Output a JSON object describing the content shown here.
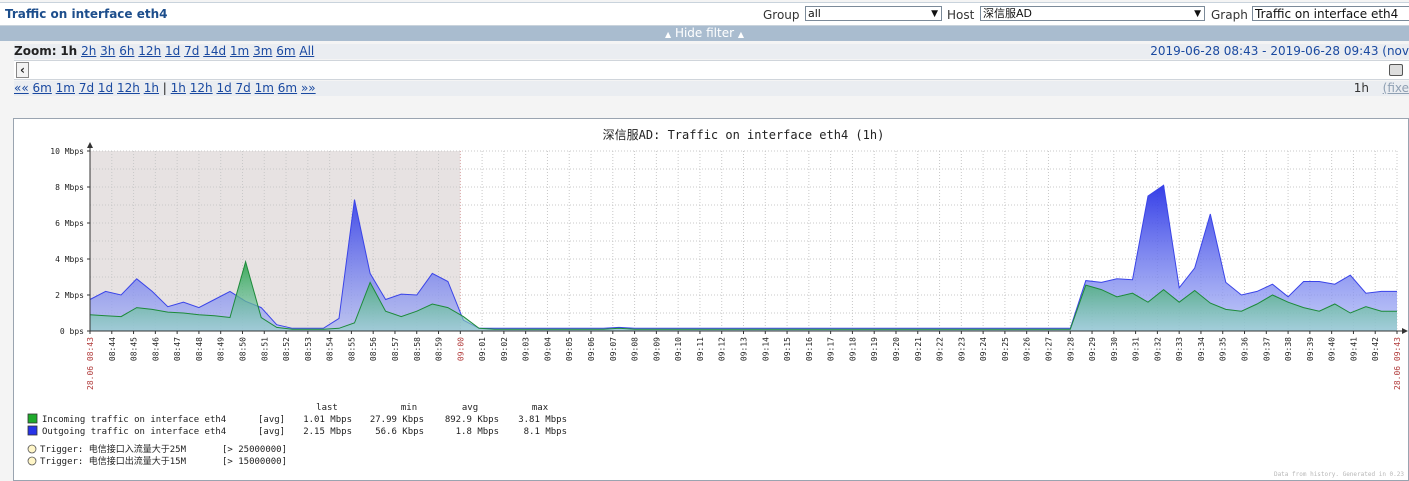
{
  "header": {
    "title": "Traffic on interface eth4",
    "group_label": "Group",
    "group_value": "all",
    "host_label": "Host",
    "host_value": "深信服AD",
    "graph_label": "Graph",
    "graph_value": "Traffic on interface eth4"
  },
  "filter_toggle": "Hide filter",
  "zoom": {
    "label": "Zoom:",
    "options": [
      "1h",
      "2h",
      "3h",
      "6h",
      "12h",
      "1d",
      "7d",
      "14d",
      "1m",
      "3m",
      "6m",
      "All"
    ],
    "active": "1h",
    "period_text": "2019-06-28 08:43  -  2019-06-28 09:43 (nov"
  },
  "nav": {
    "back_marker": "««",
    "back_options": [
      "6m",
      "1m",
      "7d",
      "1d",
      "12h",
      "1h"
    ],
    "separator": "|",
    "forward_options": [
      "1h",
      "12h",
      "1d",
      "7d",
      "1m",
      "6m"
    ],
    "forward_marker": "»»",
    "span": "1h",
    "fixed": "(fixe"
  },
  "chart_data": {
    "type": "area",
    "title": "深信服AD: Traffic on interface eth4 (1h)",
    "y_unit": "bps",
    "y_ticks": [
      "0 bps",
      "2 Mbps",
      "4 Mbps",
      "6 Mbps",
      "8 Mbps",
      "10 Mbps"
    ],
    "ylim": [
      0,
      10
    ],
    "x_ticks": [
      "08:43",
      "08:44",
      "08:45",
      "08:46",
      "08:47",
      "08:48",
      "08:49",
      "08:50",
      "08:51",
      "08:52",
      "08:53",
      "08:54",
      "08:55",
      "08:56",
      "08:57",
      "08:58",
      "08:59",
      "09:00",
      "09:01",
      "09:02",
      "09:03",
      "09:04",
      "09:05",
      "09:06",
      "09:07",
      "09:08",
      "09:09",
      "09:10",
      "09:11",
      "09:12",
      "09:13",
      "09:14",
      "09:15",
      "09:16",
      "09:17",
      "09:18",
      "09:19",
      "09:20",
      "09:21",
      "09:22",
      "09:23",
      "09:24",
      "09:25",
      "09:26",
      "09:27",
      "09:28",
      "09:29",
      "09:30",
      "09:31",
      "09:32",
      "09:33",
      "09:34",
      "09:35",
      "09:36",
      "09:37",
      "09:38",
      "09:39",
      "09:40",
      "09:41",
      "09:42",
      "09:43"
    ],
    "red_ticks": [
      "09:00"
    ],
    "date_left": "28.06 08:43",
    "date_right": "28.06 09:43",
    "grid": true,
    "shaded_until": "09:00",
    "series": [
      {
        "name": "Incoming traffic on interface eth4",
        "func": "[avg]",
        "color": "#1faa2c",
        "values": [
          0.9,
          0.85,
          0.8,
          1.3,
          1.2,
          1.05,
          1.0,
          0.9,
          0.85,
          0.75,
          3.85,
          0.75,
          0.2,
          0.1,
          0.1,
          0.1,
          0.15,
          0.45,
          2.7,
          1.1,
          0.8,
          1.1,
          1.5,
          1.3,
          0.8,
          0.15,
          0.1,
          0.1,
          0.1,
          0.1,
          0.1,
          0.1,
          0.1,
          0.1,
          0.15,
          0.1,
          0.1,
          0.1,
          0.1,
          0.1,
          0.1,
          0.1,
          0.1,
          0.1,
          0.1,
          0.1,
          0.1,
          0.1,
          0.1,
          0.1,
          0.1,
          0.1,
          0.1,
          0.1,
          0.1,
          0.1,
          0.1,
          0.1,
          0.1,
          0.1,
          0.1,
          0.1,
          0.1,
          0.1,
          2.55,
          2.3,
          1.9,
          2.1,
          1.6,
          2.3,
          1.6,
          2.25,
          1.55,
          1.2,
          1.1,
          1.5,
          2.0,
          1.6,
          1.3,
          1.1,
          1.5,
          1.0,
          1.35,
          1.1,
          1.1
        ]
      },
      {
        "name": "Outgoing traffic on interface eth4",
        "func": "[avg]",
        "color": "#2733e8",
        "values": [
          1.75,
          2.2,
          2.0,
          2.9,
          2.2,
          1.35,
          1.6,
          1.3,
          1.75,
          2.2,
          1.65,
          1.3,
          0.35,
          0.15,
          0.15,
          0.15,
          0.7,
          7.3,
          3.2,
          1.75,
          2.05,
          2.0,
          3.2,
          2.75,
          0.6,
          0.15,
          0.15,
          0.15,
          0.15,
          0.15,
          0.15,
          0.15,
          0.15,
          0.15,
          0.2,
          0.15,
          0.15,
          0.15,
          0.15,
          0.15,
          0.15,
          0.15,
          0.15,
          0.15,
          0.15,
          0.15,
          0.15,
          0.15,
          0.15,
          0.15,
          0.15,
          0.15,
          0.15,
          0.15,
          0.15,
          0.15,
          0.15,
          0.15,
          0.15,
          0.15,
          0.15,
          0.15,
          0.15,
          0.15,
          2.8,
          2.7,
          2.9,
          2.85,
          7.5,
          8.1,
          2.4,
          3.5,
          6.5,
          2.7,
          2.0,
          2.2,
          2.6,
          1.9,
          2.75,
          2.75,
          2.6,
          3.1,
          2.1,
          2.2,
          2.2
        ]
      }
    ],
    "legend_header": [
      "last",
      "min",
      "avg",
      "max"
    ],
    "legend_rows": [
      {
        "name": "Incoming traffic on interface eth4",
        "func": "[avg]",
        "last": "1.01 Mbps",
        "min": "27.99 Kbps",
        "avg": "892.9 Kbps",
        "max": "3.81 Mbps",
        "color": "#1faa2c"
      },
      {
        "name": "Outgoing traffic on interface eth4",
        "func": "[avg]",
        "last": "2.15 Mbps",
        "min": "56.6 Kbps",
        "avg": "1.8 Mbps",
        "max": "8.1 Mbps",
        "color": "#2733e8"
      }
    ],
    "triggers": [
      {
        "label": "Trigger: 电信接口入流量大于25M",
        "cond": "[> 25000000]"
      },
      {
        "label": "Trigger: 电信接口出流量大于15M",
        "cond": "[> 15000000]"
      }
    ],
    "footer": "Data from history. Generated in 0.23"
  }
}
